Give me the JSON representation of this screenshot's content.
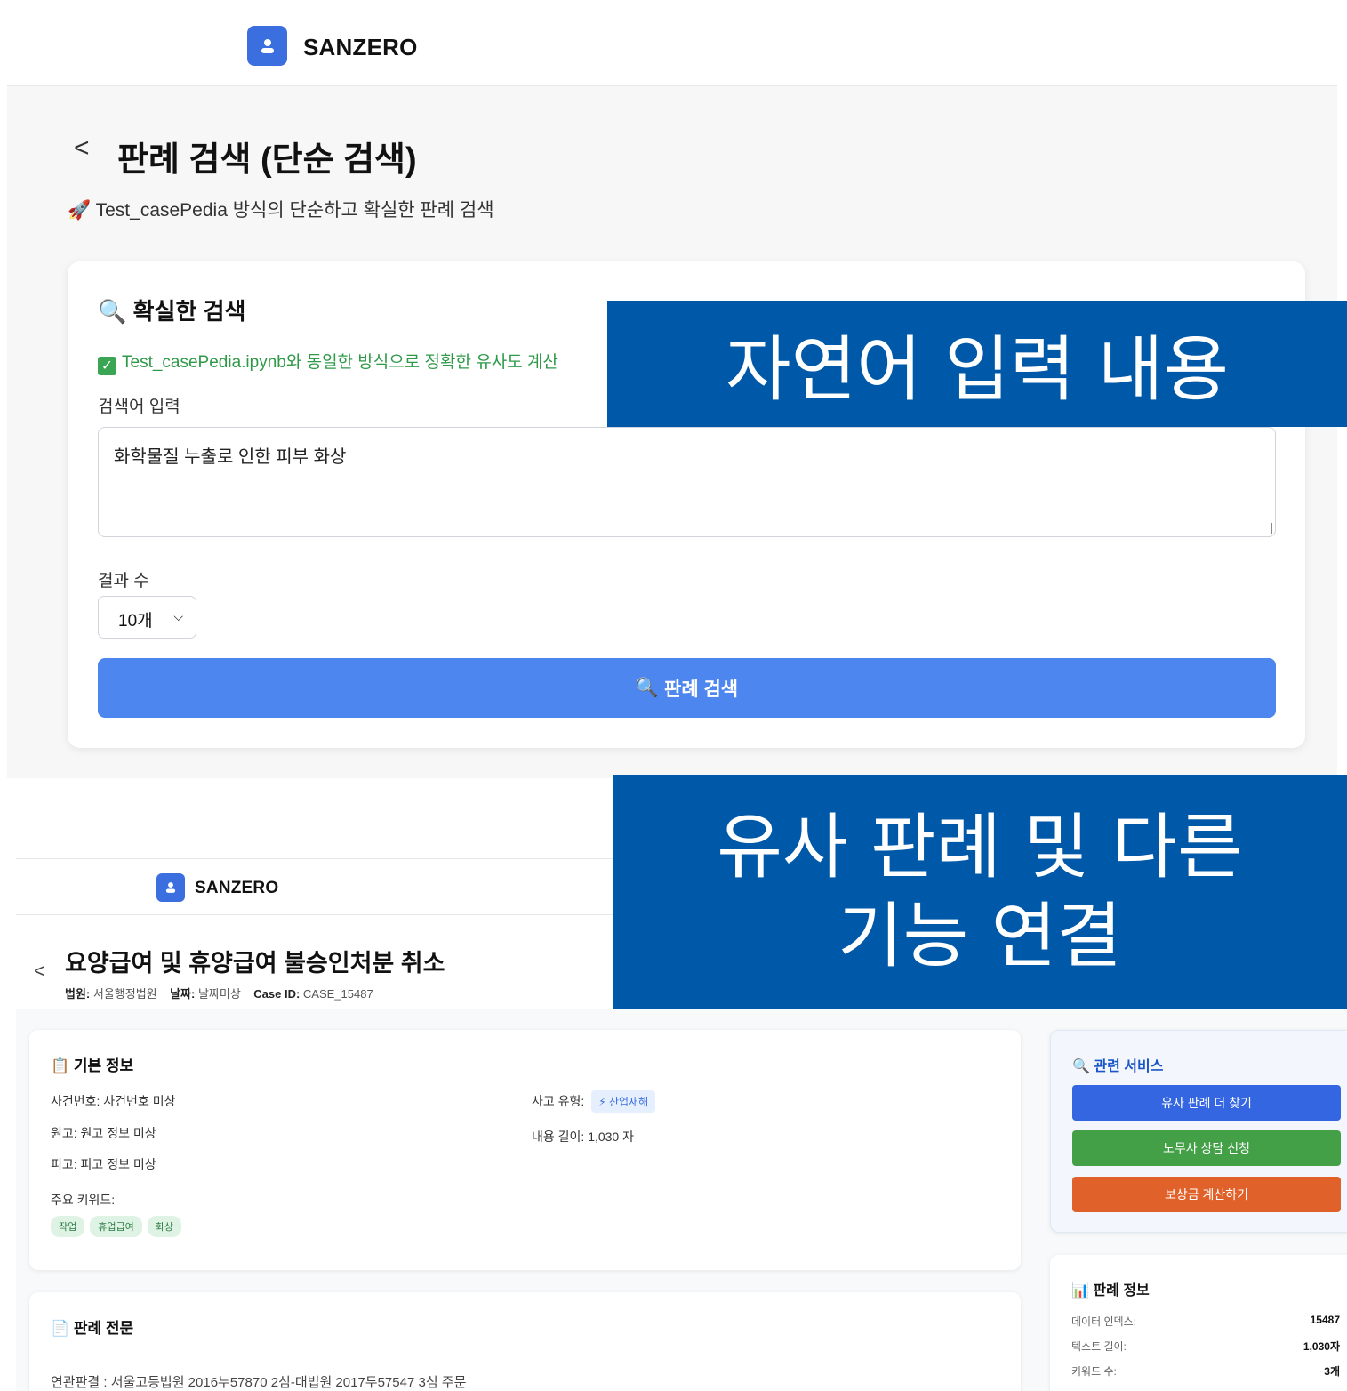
{
  "top": {
    "brand": "SANZERO",
    "back_glyph": "<",
    "title": "판례 검색 (단순 검색)",
    "subtitle_icon": "🚀",
    "subtitle": "Test_casePedia 방식의 단순하고 확실한 판례 검색",
    "card": {
      "title_icon": "🔍",
      "title": "확실한 검색",
      "ok_check": "✓",
      "ok_text": "Test_casePedia.ipynb와 동일한 방식으로 정확한 유사도 계산",
      "query_label": "검색어 입력",
      "query_value": "화학물질 누출로 인한 피부 화상",
      "count_label": "결과 수",
      "count_value": "10개",
      "search_icon": "🔍",
      "search_button": "판례 검색"
    }
  },
  "bottom": {
    "brand": "SANZERO",
    "back_glyph": "<",
    "title": "요양급여 및 휴양급여 불승인처분 취소",
    "meta": {
      "court_label": "법원:",
      "court": "서울행정법원",
      "date_label": "날짜:",
      "date": "날짜미상",
      "caseid_label": "Case ID:",
      "caseid": "CASE_15487"
    },
    "basic": {
      "icon": "📋",
      "title": "기본 정보",
      "case_no": "사건번호: 사건번호 미상",
      "plaintiff": "원고: 원고 정보 미상",
      "defendant": "피고: 피고 정보 미상",
      "keywords_label": "주요 키워드:",
      "keywords": [
        "작업",
        "휴업급여",
        "화상"
      ],
      "type_label": "사고 유형:",
      "type_icon": "⚡",
      "type_value": "산업재해",
      "length": "내용 길이: 1,030 자"
    },
    "fulltext": {
      "icon": "📄",
      "title": "판례 전문",
      "first_line": "연관판결 : 서울고등법원 2016누57870 2심-대법원 2017두57547 3심 주문"
    },
    "services": {
      "icon": "🔍",
      "title": "관련 서비스",
      "buttons": [
        {
          "label": "유사 판례 더 찾기",
          "color": "#3366e0"
        },
        {
          "label": "노무사 상담 신청",
          "color": "#43a047"
        },
        {
          "label": "보상금 계산하기",
          "color": "#e0622a"
        }
      ]
    },
    "info": {
      "icon": "📊",
      "title": "판례 정보",
      "rows": [
        {
          "k": "데이터 인덱스:",
          "v": "15487"
        },
        {
          "k": "텍스트 길이:",
          "v": "1,030자"
        },
        {
          "k": "키워드 수:",
          "v": "3개"
        }
      ]
    }
  },
  "overlays": {
    "first": "자연어 입력 내용",
    "second_line1": "유사 판례 및 다른",
    "second_line2": "기능 연결"
  }
}
